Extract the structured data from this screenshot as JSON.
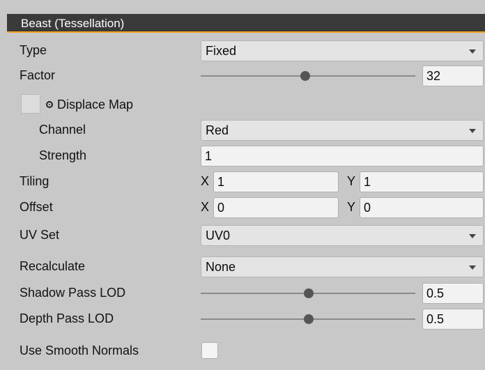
{
  "header": {
    "title": "Beast (Tessellation)"
  },
  "type": {
    "label": "Type",
    "value": "Fixed"
  },
  "factor": {
    "label": "Factor",
    "value": "32",
    "slider_fraction": 0.49
  },
  "displace_map": {
    "label": "Displace Map",
    "icon": "object-picker-icon"
  },
  "channel": {
    "label": "Channel",
    "value": "Red"
  },
  "strength": {
    "label": "Strength",
    "value": "1"
  },
  "tiling": {
    "label": "Tiling",
    "x_label": "X",
    "x": "1",
    "y_label": "Y",
    "y": "1"
  },
  "offset": {
    "label": "Offset",
    "x_label": "X",
    "x": "0",
    "y_label": "Y",
    "y": "0"
  },
  "uv_set": {
    "label": "UV Set",
    "value": "UV0"
  },
  "recalculate": {
    "label": "Recalculate",
    "value": "None"
  },
  "shadow_pass_lod": {
    "label": "Shadow Pass LOD",
    "value": "0.5",
    "slider_fraction": 0.5
  },
  "depth_pass_lod": {
    "label": "Depth Pass LOD",
    "value": "0.5",
    "slider_fraction": 0.5
  },
  "use_smooth_normals": {
    "label": "Use Smooth Normals",
    "checked": false
  },
  "colors": {
    "header_bg": "#3a3a3a",
    "header_accent": "#f0a01c",
    "panel_bg": "#c8c8c8"
  }
}
